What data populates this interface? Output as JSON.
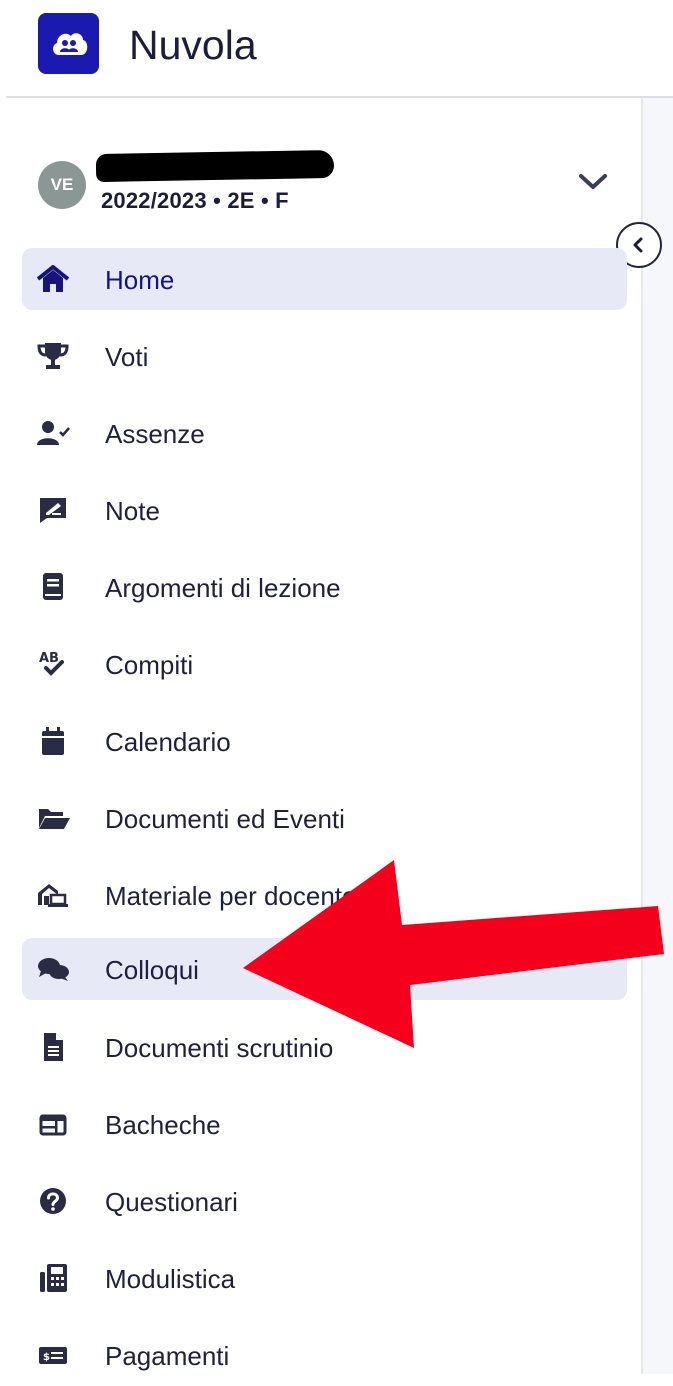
{
  "app": {
    "name": "Nuvola"
  },
  "user": {
    "initials": "VE",
    "meta": "2022/2023 • 2E • F"
  },
  "nav": {
    "items": [
      {
        "label": "Home",
        "icon": "home-icon",
        "active": true
      },
      {
        "label": "Voti",
        "icon": "trophy-icon"
      },
      {
        "label": "Assenze",
        "icon": "user-check-icon"
      },
      {
        "label": "Note",
        "icon": "signature-note-icon"
      },
      {
        "label": "Argomenti di lezione",
        "icon": "book-icon"
      },
      {
        "label": "Compiti",
        "icon": "spellcheck-icon"
      },
      {
        "label": "Calendario",
        "icon": "calendar-icon"
      },
      {
        "label": "Documenti ed Eventi",
        "icon": "folder-open-icon"
      },
      {
        "label": "Materiale per docente",
        "icon": "house-laptop-icon"
      },
      {
        "label": "Colloqui",
        "icon": "comments-icon",
        "highlighted": true
      },
      {
        "label": "Documenti scrutinio",
        "icon": "file-lines-icon"
      },
      {
        "label": "Bacheche",
        "icon": "board-icon"
      },
      {
        "label": "Questionari",
        "icon": "question-circle-icon"
      },
      {
        "label": "Modulistica",
        "icon": "fax-icon"
      },
      {
        "label": "Pagamenti",
        "icon": "money-bill-icon"
      }
    ]
  },
  "colors": {
    "brand": "#1a1ab0",
    "active_bg": "#e8e9f7",
    "text": "#1f2040",
    "annotation_arrow": "#f5001c"
  }
}
